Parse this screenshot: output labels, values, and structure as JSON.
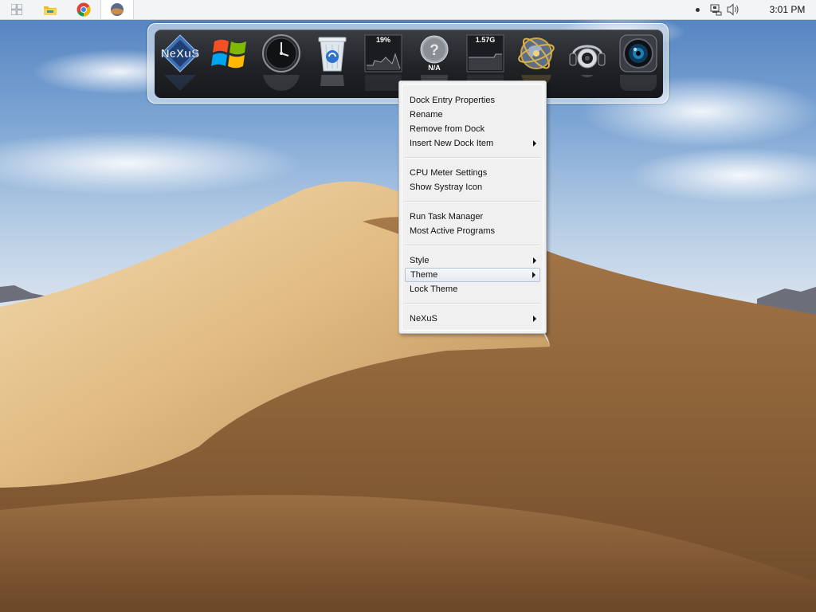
{
  "taskbar": {
    "apps": [
      {
        "name": "Start"
      },
      {
        "name": "File Explorer"
      },
      {
        "name": "Google Chrome"
      },
      {
        "name": "Winstep Nexus"
      }
    ],
    "clock": "3:01 PM"
  },
  "dock": {
    "items": [
      {
        "name": "Winstep Nexus",
        "icon": "nexus-logo-icon",
        "text": "NeXuS"
      },
      {
        "name": "Windows Start",
        "icon": "windows-logo-icon"
      },
      {
        "name": "Clock",
        "icon": "clock-icon"
      },
      {
        "name": "Recycle Bin",
        "icon": "recycle-bin-icon"
      },
      {
        "name": "CPU Meter",
        "icon": "cpu-meter-icon",
        "label": "19%"
      },
      {
        "name": "Weather",
        "icon": "weather-unknown-icon",
        "label": "N/A"
      },
      {
        "name": "Memory Meter",
        "icon": "memory-meter-icon",
        "label": "1.57G"
      },
      {
        "name": "Internet",
        "icon": "globe-icon"
      },
      {
        "name": "Media Player",
        "icon": "speaker-headphones-icon"
      },
      {
        "name": "Camera",
        "icon": "camera-lens-icon"
      }
    ]
  },
  "context_menu": {
    "groups": [
      [
        {
          "label": "Dock Entry Properties",
          "submenu": false
        },
        {
          "label": "Rename",
          "submenu": false
        },
        {
          "label": "Remove from Dock",
          "submenu": false
        },
        {
          "label": "Insert New Dock Item",
          "submenu": true
        }
      ],
      [
        {
          "label": "CPU Meter Settings",
          "submenu": false
        },
        {
          "label": "Show Systray Icon",
          "submenu": false
        }
      ],
      [
        {
          "label": "Run Task Manager",
          "submenu": false
        },
        {
          "label": "Most Active Programs",
          "submenu": false
        }
      ],
      [
        {
          "label": "Style",
          "submenu": true
        },
        {
          "label": "Theme",
          "submenu": true,
          "highlighted": true
        },
        {
          "label": "Lock Theme",
          "submenu": false
        }
      ],
      [
        {
          "label": "NeXuS",
          "submenu": true
        }
      ]
    ]
  },
  "colors": {
    "menu_background": "#f0f0f0",
    "menu_highlight_border": "#b8c4d6",
    "dock_background": "#202226",
    "taskbar_background": "#f3f4f6"
  }
}
